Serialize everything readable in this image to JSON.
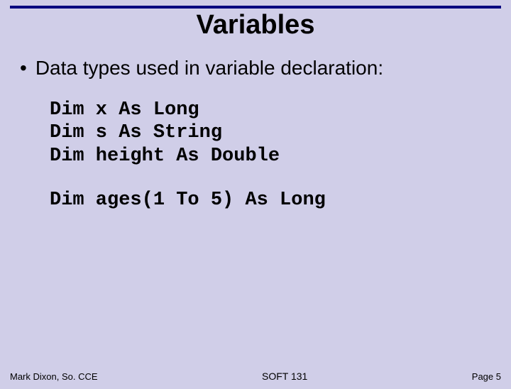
{
  "title": "Variables",
  "bullet": "Data types used in variable declaration:",
  "code1": "Dim x As Long\nDim s As String\nDim height As Double",
  "code2": "Dim ages(1 To 5) As Long",
  "footer": {
    "left": "Mark Dixon, So. CCE",
    "center": "SOFT 131",
    "right": "Page 5"
  }
}
